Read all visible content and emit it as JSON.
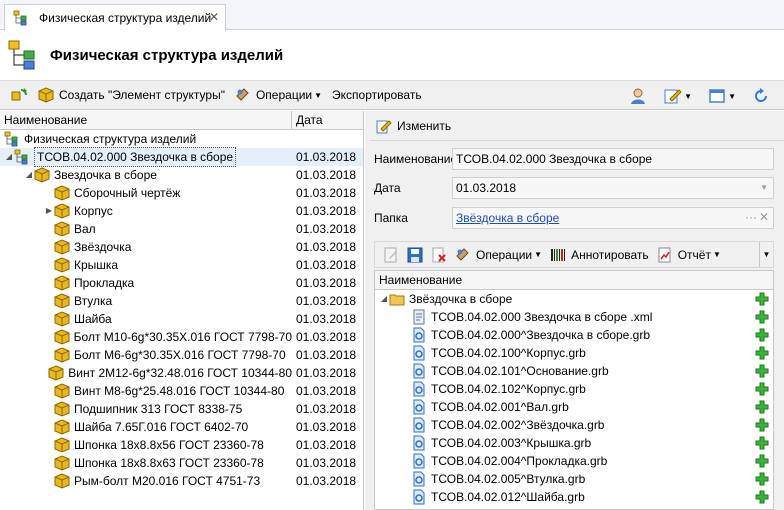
{
  "tab": {
    "title": "Физическая структура изделий",
    "close": "✕"
  },
  "header": {
    "title": "Физическая структура изделий"
  },
  "toolbar": {
    "create_label": "Создать \"Элемент структуры\"",
    "operations_label": "Операции",
    "export_label": "Экспортировать"
  },
  "tree": {
    "columns": {
      "name": "Наименование",
      "date": "Дата"
    },
    "root": "Физическая структура изделий",
    "assembly": {
      "name": "ТСОВ.04.02.000 Звездочка в сборе",
      "date": "01.03.2018"
    },
    "group": {
      "name": "Звездочка в сборе",
      "date": "01.03.2018"
    },
    "items": [
      {
        "name": "Сборочный чертёж",
        "date": "01.03.2018",
        "expandable": false
      },
      {
        "name": "Корпус",
        "date": "01.03.2018",
        "expandable": true
      },
      {
        "name": "Вал",
        "date": "01.03.2018",
        "expandable": false
      },
      {
        "name": "Звёздочка",
        "date": "01.03.2018",
        "expandable": false
      },
      {
        "name": "Крышка",
        "date": "01.03.2018",
        "expandable": false
      },
      {
        "name": "Прокладка",
        "date": "01.03.2018",
        "expandable": false
      },
      {
        "name": "Втулка",
        "date": "01.03.2018",
        "expandable": false
      },
      {
        "name": "Шайба",
        "date": "01.03.2018",
        "expandable": false
      },
      {
        "name": "Болт М10-6g*30.35Х.016 ГОСТ 7798-70",
        "date": "01.03.2018",
        "expandable": false
      },
      {
        "name": "Болт М6-6g*30.35Х.016 ГОСТ 7798-70",
        "date": "01.03.2018",
        "expandable": false
      },
      {
        "name": "Винт 2М12-6g*32.48.016 ГОСТ 10344-80",
        "date": "01.03.2018",
        "expandable": false
      },
      {
        "name": "Винт М8-6g*25.48.016 ГОСТ 10344-80",
        "date": "01.03.2018",
        "expandable": false
      },
      {
        "name": "Подшипник 313 ГОСТ 8338-75",
        "date": "01.03.2018",
        "expandable": false
      },
      {
        "name": "Шайба 7.65Г.016 ГОСТ 6402-70",
        "date": "01.03.2018",
        "expandable": false
      },
      {
        "name": "Шпонка 18х8.8х56 ГОСТ 23360-78",
        "date": "01.03.2018",
        "expandable": false
      },
      {
        "name": "Шпонка 18х8.8х63 ГОСТ 23360-78",
        "date": "01.03.2018",
        "expandable": false
      },
      {
        "name": "Рым-болт М20.016 ГОСТ 4751-73",
        "date": "01.03.2018",
        "expandable": false
      }
    ]
  },
  "details": {
    "edit_label": "Изменить",
    "name_label": "Наименование",
    "name_value": "ТСОВ.04.02.000 Звездочка в сборе",
    "date_label": "Дата",
    "date_value": "01.03.2018",
    "folder_label": "Папка",
    "folder_value": "Звёздочка в сборе",
    "folder_dots": "···",
    "folder_clear": "✕"
  },
  "sub_toolbar": {
    "operations_label": "Операции",
    "annotate_label": "Аннотировать",
    "report_label": "Отчёт"
  },
  "documents": {
    "column": "Наименование",
    "folder": "Звёздочка в сборе",
    "items": [
      {
        "name": "ТСОВ.04.02.000 Звездочка в сборе .xml",
        "type": "xml"
      },
      {
        "name": "ТСОВ.04.02.000^Звездочка в сборе.grb",
        "type": "grb"
      },
      {
        "name": "ТСОВ.04.02.100^Корпус.grb",
        "type": "grb"
      },
      {
        "name": "ТСОВ.04.02.101^Основание.grb",
        "type": "grb"
      },
      {
        "name": "ТСОВ.04.02.102^Корпус.grb",
        "type": "grb"
      },
      {
        "name": "ТСОВ.04.02.001^Вал.grb",
        "type": "grb"
      },
      {
        "name": "ТСОВ.04.02.002^Звёздочка.grb",
        "type": "grb"
      },
      {
        "name": "ТСОВ.04.02.003^Крышка.grb",
        "type": "grb"
      },
      {
        "name": "ТСОВ.04.02.004^Прокладка.grb",
        "type": "grb"
      },
      {
        "name": "ТСОВ.04.02.005^Втулка.grb",
        "type": "grb"
      },
      {
        "name": "ТСОВ.04.02.012^Шайба.grb",
        "type": "grb"
      }
    ]
  }
}
